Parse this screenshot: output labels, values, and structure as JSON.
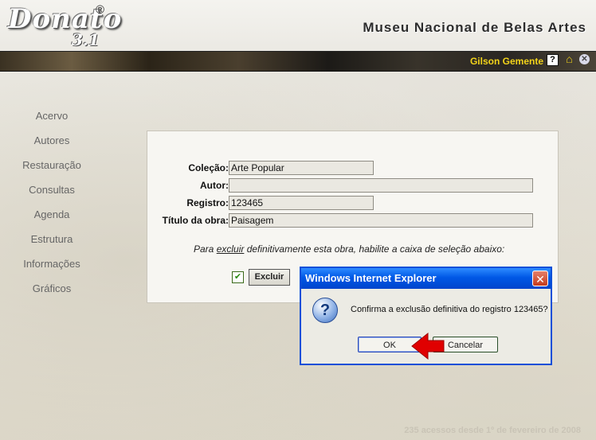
{
  "header": {
    "logo_text": "Donato",
    "logo_version": "3.1",
    "logo_reg": "®",
    "site_title": "Museu Nacional de Belas Artes",
    "user_name": "Gilson Gemente",
    "icons": [
      "help-icon",
      "home-icon",
      "close-icon"
    ]
  },
  "sidebar": {
    "items": [
      {
        "label": "Acervo"
      },
      {
        "label": "Autores"
      },
      {
        "label": "Restauração"
      },
      {
        "label": "Consultas"
      },
      {
        "label": "Agenda"
      },
      {
        "label": "Estrutura"
      },
      {
        "label": "Informações"
      },
      {
        "label": "Gráficos"
      }
    ]
  },
  "form": {
    "colecao_label": "Coleção:",
    "colecao_value": "Arte Popular",
    "autor_label": "Autor:",
    "autor_value": "",
    "registro_label": "Registro:",
    "registro_value": "123465",
    "titulo_label": "Título da obra:",
    "titulo_value": "Paisagem",
    "hint_before": "Para ",
    "hint_link": "excluir",
    "hint_after": " definitivamente esta obra, habilite a caixa de seleção abaixo:",
    "checkbox_checked": true,
    "excluir_button": "Excluir"
  },
  "dialog": {
    "title": "Windows Internet Explorer",
    "message": "Confirma a exclusão definitiva do registro 123465?",
    "ok_label": "OK",
    "cancel_label": "Cancelar"
  },
  "footer": {
    "text": "235 acessos desde 1º de fevereiro de 2008"
  },
  "colors": {
    "accent_user": "#f2d31a",
    "dialog_title": "#0058e6",
    "arrow": "#e00000"
  }
}
